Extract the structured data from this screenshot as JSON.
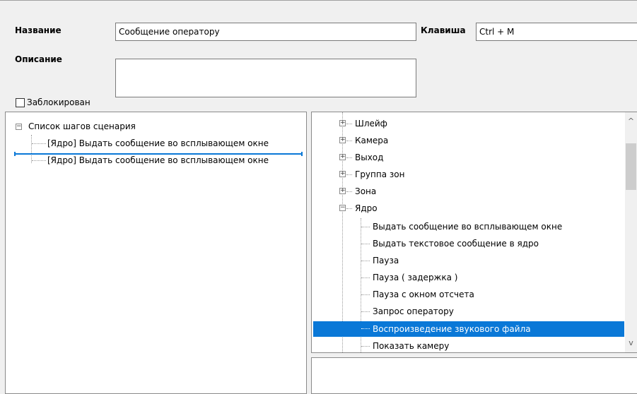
{
  "form": {
    "name_label": "Название",
    "name_value": "Сообщение оператору",
    "key_label": "Клавиша",
    "key_value": "Ctrl + M",
    "description_label": "Описание",
    "description_value": "",
    "blocked_label": "Заблокирован",
    "blocked_checked": false
  },
  "steps_tree": {
    "root_label": "Список шагов сценария",
    "items": [
      "[Ядро] Выдать сообщение во всплывающем окне",
      "[Ядро] Выдать сообщение во всплывающем окне"
    ]
  },
  "actions_tree": {
    "groups": [
      "Шлейф",
      "Камера",
      "Выход",
      "Группа зон",
      "Зона",
      "Ядро"
    ],
    "core_items": [
      "Выдать сообщение во всплывающем окне",
      "Выдать текстовое сообщение в ядро",
      "Пауза",
      "Пауза ( задержка )",
      "Пауза с окном отсчета",
      "Запрос оператору",
      "Воспроизведение звукового файла",
      "Показать камеру"
    ],
    "selected_item": "Воспроизведение звукового файла"
  },
  "colors": {
    "selection": "#0a78d7",
    "drop_marker": "#0a78d7"
  }
}
